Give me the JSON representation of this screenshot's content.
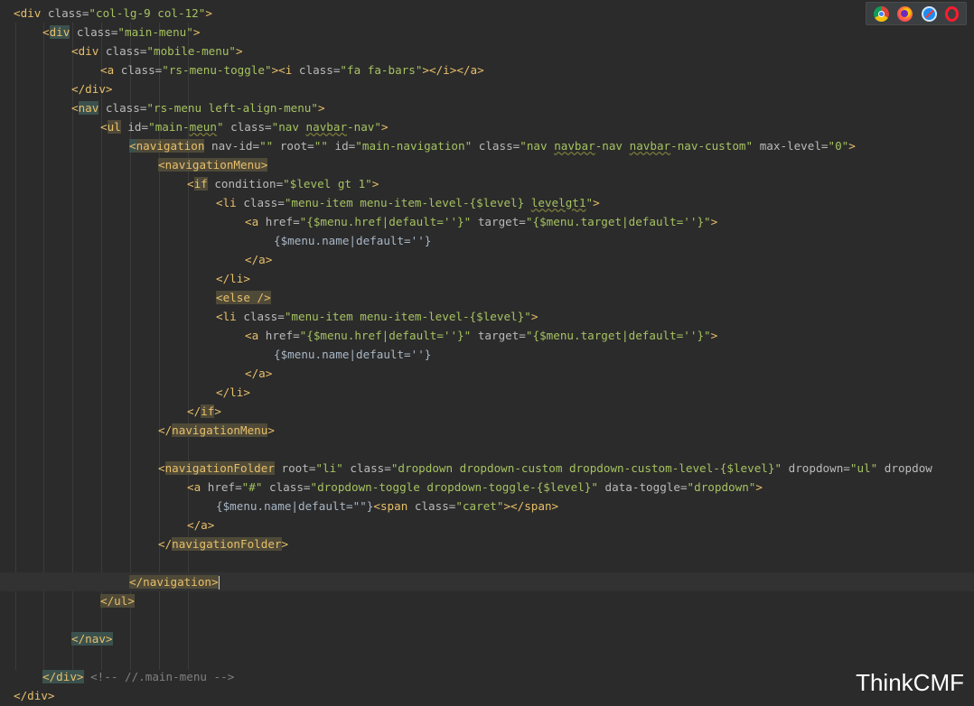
{
  "toolbar": {
    "icons": [
      {
        "name": "chrome-icon"
      },
      {
        "name": "firefox-icon"
      },
      {
        "name": "safari-icon"
      },
      {
        "name": "opera-icon"
      }
    ]
  },
  "watermark": "ThinkCMF",
  "lines": [
    {
      "indent": 0,
      "tokens": [
        {
          "t": "tag",
          "v": "<div "
        },
        {
          "t": "attr",
          "v": "class="
        },
        {
          "t": "str",
          "v": "\"col-lg-9 col-12\""
        },
        {
          "t": "tag",
          "v": ">"
        }
      ]
    },
    {
      "indent": 1,
      "tokens": [
        {
          "t": "tag",
          "v": "<"
        },
        {
          "t": "tag",
          "v": "div",
          "hl": "hl"
        },
        {
          "t": "attr",
          "v": " class="
        },
        {
          "t": "str",
          "v": "\"main-menu\""
        },
        {
          "t": "tag",
          "v": ">"
        }
      ]
    },
    {
      "indent": 2,
      "tokens": [
        {
          "t": "tag",
          "v": "<div "
        },
        {
          "t": "attr",
          "v": "class="
        },
        {
          "t": "str",
          "v": "\"mobile-menu\""
        },
        {
          "t": "tag",
          "v": ">"
        }
      ]
    },
    {
      "indent": 3,
      "tokens": [
        {
          "t": "tag",
          "v": "<a "
        },
        {
          "t": "attr",
          "v": "class="
        },
        {
          "t": "str",
          "v": "\"rs-menu-toggle\""
        },
        {
          "t": "tag",
          "v": "><i "
        },
        {
          "t": "attr",
          "v": "class="
        },
        {
          "t": "str",
          "v": "\"fa fa-bars\""
        },
        {
          "t": "tag",
          "v": "></i></a>"
        }
      ]
    },
    {
      "indent": 2,
      "tokens": [
        {
          "t": "tag",
          "v": "</div>"
        }
      ]
    },
    {
      "indent": 2,
      "tokens": [
        {
          "t": "tag",
          "v": "<"
        },
        {
          "t": "tag",
          "v": "nav",
          "hl": "hl"
        },
        {
          "t": "attr",
          "v": " class="
        },
        {
          "t": "str",
          "v": "\"rs-menu left-align-menu\""
        },
        {
          "t": "tag",
          "v": ">"
        }
      ]
    },
    {
      "indent": 3,
      "tokens": [
        {
          "t": "tag",
          "v": "<"
        },
        {
          "t": "tag",
          "v": "ul",
          "hl": "hl2"
        },
        {
          "t": "attr",
          "v": " id="
        },
        {
          "t": "str",
          "v": "\"main-"
        },
        {
          "t": "str",
          "v": "meun",
          "sq": true
        },
        {
          "t": "str",
          "v": "\""
        },
        {
          "t": "attr",
          "v": " class="
        },
        {
          "t": "str",
          "v": "\"nav "
        },
        {
          "t": "str",
          "v": "navbar",
          "sq": true
        },
        {
          "t": "str",
          "v": "-nav\""
        },
        {
          "t": "tag",
          "v": ">"
        }
      ]
    },
    {
      "indent": 4,
      "tokens": [
        {
          "t": "tag",
          "v": "<",
          "hl": "hl"
        },
        {
          "t": "tag",
          "v": "navigation",
          "hl": "hl2"
        },
        {
          "t": "attr",
          "v": " nav-id="
        },
        {
          "t": "str",
          "v": "\"\""
        },
        {
          "t": "attr",
          "v": " root="
        },
        {
          "t": "str",
          "v": "\"\""
        },
        {
          "t": "attr",
          "v": " id="
        },
        {
          "t": "str",
          "v": "\"main-navigation\""
        },
        {
          "t": "attr",
          "v": " class="
        },
        {
          "t": "str",
          "v": "\"nav "
        },
        {
          "t": "str",
          "v": "navbar",
          "sq": true
        },
        {
          "t": "str",
          "v": "-nav "
        },
        {
          "t": "str",
          "v": "navbar",
          "sq": true
        },
        {
          "t": "str",
          "v": "-nav-custom\""
        },
        {
          "t": "attr",
          "v": " max-level="
        },
        {
          "t": "str",
          "v": "\"0\""
        },
        {
          "t": "tag",
          "v": ">"
        }
      ]
    },
    {
      "indent": 5,
      "tokens": [
        {
          "t": "tag",
          "v": "<navigationMenu>",
          "hl": "hl2"
        }
      ]
    },
    {
      "indent": 6,
      "tokens": [
        {
          "t": "tag",
          "v": "<"
        },
        {
          "t": "tag",
          "v": "if",
          "hl": "hl2"
        },
        {
          "t": "attr",
          "v": " condition="
        },
        {
          "t": "str",
          "v": "\"$level gt 1\""
        },
        {
          "t": "tag",
          "v": ">"
        }
      ]
    },
    {
      "indent": 7,
      "tokens": [
        {
          "t": "tag",
          "v": "<li "
        },
        {
          "t": "attr",
          "v": "class="
        },
        {
          "t": "str",
          "v": "\"menu-item menu-item-level-{$level} "
        },
        {
          "t": "str",
          "v": "levelgt1",
          "sq": true
        },
        {
          "t": "str",
          "v": "\""
        },
        {
          "t": "tag",
          "v": ">"
        }
      ]
    },
    {
      "indent": 8,
      "tokens": [
        {
          "t": "tag",
          "v": "<a "
        },
        {
          "t": "attr",
          "v": "href="
        },
        {
          "t": "str",
          "v": "\"{$menu.href|default=''}\""
        },
        {
          "t": "attr",
          "v": " target="
        },
        {
          "t": "str",
          "v": "\"{$menu.target|default=''}\""
        },
        {
          "t": "tag",
          "v": ">"
        }
      ]
    },
    {
      "indent": 9,
      "tokens": [
        {
          "t": "text",
          "v": "{$menu.name|default=''}"
        }
      ]
    },
    {
      "indent": 8,
      "tokens": [
        {
          "t": "tag",
          "v": "</a>"
        }
      ]
    },
    {
      "indent": 7,
      "tokens": [
        {
          "t": "tag",
          "v": "</li>"
        }
      ]
    },
    {
      "indent": 7,
      "tokens": [
        {
          "t": "tag",
          "v": "<else />",
          "hl": "hl2"
        }
      ]
    },
    {
      "indent": 7,
      "tokens": [
        {
          "t": "tag",
          "v": "<li "
        },
        {
          "t": "attr",
          "v": "class="
        },
        {
          "t": "str",
          "v": "\"menu-item menu-item-level-{$level}\""
        },
        {
          "t": "tag",
          "v": ">"
        }
      ]
    },
    {
      "indent": 8,
      "tokens": [
        {
          "t": "tag",
          "v": "<a "
        },
        {
          "t": "attr",
          "v": "href="
        },
        {
          "t": "str",
          "v": "\"{$menu.href|default=''}\""
        },
        {
          "t": "attr",
          "v": " target="
        },
        {
          "t": "str",
          "v": "\"{$menu.target|default=''}\""
        },
        {
          "t": "tag",
          "v": ">"
        }
      ]
    },
    {
      "indent": 9,
      "tokens": [
        {
          "t": "text",
          "v": "{$menu.name|default=''}"
        }
      ]
    },
    {
      "indent": 8,
      "tokens": [
        {
          "t": "tag",
          "v": "</a>"
        }
      ]
    },
    {
      "indent": 7,
      "tokens": [
        {
          "t": "tag",
          "v": "</li>"
        }
      ]
    },
    {
      "indent": 6,
      "tokens": [
        {
          "t": "tag",
          "v": "</"
        },
        {
          "t": "tag",
          "v": "if",
          "hl": "hl2"
        },
        {
          "t": "tag",
          "v": ">"
        }
      ]
    },
    {
      "indent": 5,
      "tokens": [
        {
          "t": "tag",
          "v": "</"
        },
        {
          "t": "tag",
          "v": "navigationMenu",
          "hl": "hl2"
        },
        {
          "t": "tag",
          "v": ">"
        }
      ]
    },
    {
      "indent": 0,
      "tokens": []
    },
    {
      "indent": 5,
      "tokens": [
        {
          "t": "tag",
          "v": "<"
        },
        {
          "t": "tag",
          "v": "navigationFolder",
          "hl": "hl2"
        },
        {
          "t": "attr",
          "v": " root="
        },
        {
          "t": "str",
          "v": "\"li\""
        },
        {
          "t": "attr",
          "v": " class="
        },
        {
          "t": "str",
          "v": "\"dropdown dropdown-custom dropdown-custom-level-{$level}\""
        },
        {
          "t": "attr",
          "v": " dropdown="
        },
        {
          "t": "str",
          "v": "\"ul\""
        },
        {
          "t": "attr",
          "v": " dropdow"
        }
      ]
    },
    {
      "indent": 6,
      "tokens": [
        {
          "t": "tag",
          "v": "<a "
        },
        {
          "t": "attr",
          "v": "href="
        },
        {
          "t": "str",
          "v": "\"#\""
        },
        {
          "t": "attr",
          "v": " class="
        },
        {
          "t": "str",
          "v": "\"dropdown-toggle dropdown-toggle-{$level}\""
        },
        {
          "t": "attr",
          "v": " data-toggle="
        },
        {
          "t": "str",
          "v": "\"dropdown\""
        },
        {
          "t": "tag",
          "v": ">"
        }
      ]
    },
    {
      "indent": 7,
      "tokens": [
        {
          "t": "text",
          "v": "{$menu.name|default=\"\"}"
        },
        {
          "t": "tag",
          "v": "<span "
        },
        {
          "t": "attr",
          "v": "class="
        },
        {
          "t": "str",
          "v": "\"caret\""
        },
        {
          "t": "tag",
          "v": "></span>"
        }
      ]
    },
    {
      "indent": 6,
      "tokens": [
        {
          "t": "tag",
          "v": "</a>"
        }
      ]
    },
    {
      "indent": 5,
      "tokens": [
        {
          "t": "tag",
          "v": "</"
        },
        {
          "t": "tag",
          "v": "navigationFolder",
          "hl": "hl2"
        },
        {
          "t": "tag",
          "v": ">"
        }
      ]
    },
    {
      "indent": 0,
      "tokens": []
    },
    {
      "indent": 4,
      "current": true,
      "tokens": [
        {
          "t": "tag",
          "v": "</",
          "hl": "hl2"
        },
        {
          "t": "tag",
          "v": "navigation",
          "hl": "hl2"
        },
        {
          "t": "tag",
          "v": ">",
          "hl": "hl2"
        },
        {
          "t": "caret",
          "v": ""
        }
      ]
    },
    {
      "indent": 3,
      "tokens": [
        {
          "t": "tag",
          "v": "</ul>",
          "hl": "hl2"
        }
      ]
    },
    {
      "indent": 0,
      "tokens": []
    },
    {
      "indent": 2,
      "tokens": [
        {
          "t": "tag",
          "v": "</nav>",
          "hl": "hl"
        }
      ]
    },
    {
      "indent": 0,
      "tokens": []
    },
    {
      "indent": 1,
      "tokens": [
        {
          "t": "tag",
          "v": "</div>",
          "hl": "hl"
        },
        {
          "t": "cmt",
          "v": " <!-- //.main-menu -->"
        }
      ]
    },
    {
      "indent": 0,
      "tokens": [
        {
          "t": "tag",
          "v": "</div>"
        }
      ]
    }
  ]
}
